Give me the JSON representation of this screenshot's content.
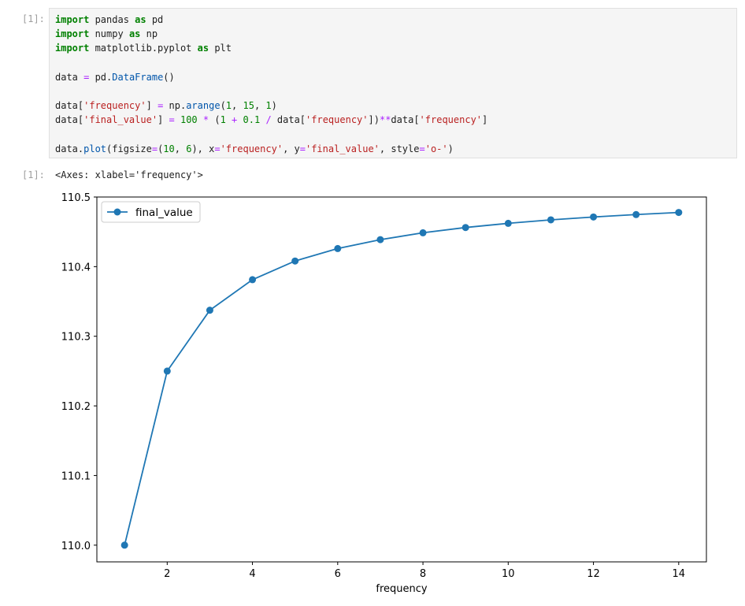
{
  "input_prompt": "[1]:",
  "output_prompt": "[1]:",
  "code": {
    "line1": {
      "kw1": "import",
      "mod": " pandas ",
      "kw2": "as",
      "alias": " pd"
    },
    "line2": {
      "kw1": "import",
      "mod": " numpy ",
      "kw2": "as",
      "alias": " np"
    },
    "line3": {
      "kw1": "import",
      "mod": " matplotlib.pyplot ",
      "kw2": "as",
      "alias": " plt"
    },
    "line5": {
      "a": "data ",
      "op": "=",
      "b": " pd.",
      "fn": "DataFrame",
      "c": "()"
    },
    "line7": {
      "a": "data[",
      "s1": "'frequency'",
      "b": "] ",
      "op1": "=",
      "c": " np.",
      "fn": "arange",
      "d": "(",
      "n1": "1",
      "e": ", ",
      "n2": "15",
      "f": ", ",
      "n3": "1",
      "g": ")"
    },
    "line8": {
      "a": "data[",
      "s1": "'final_value'",
      "b": "] ",
      "op1": "=",
      "c": " ",
      "n1": "100",
      "d": " ",
      "op2": "*",
      "e": " (",
      "n2": "1",
      "f": " ",
      "op3": "+",
      "g": " ",
      "n3": "0.1",
      "h": " ",
      "op4": "/",
      "i": " data[",
      "s2": "'frequency'",
      "j": "])",
      "op5": "**",
      "k": "data[",
      "s3": "'frequency'",
      "l": "]"
    },
    "line10": {
      "a": "data.",
      "fn": "plot",
      "b": "(figsize",
      "op1": "=",
      "c": "(",
      "n1": "10",
      "d": ", ",
      "n2": "6",
      "e": "), x",
      "op2": "=",
      "s1": "'frequency'",
      "f": ", y",
      "op3": "=",
      "s2": "'final_value'",
      "g": ", style",
      "op4": "=",
      "s3": "'o-'",
      "h": ")"
    }
  },
  "output_text": "<Axes: xlabel='frequency'>",
  "colors": {
    "series": "#1f77b4"
  },
  "chart_data": {
    "type": "line",
    "x": [
      1,
      2,
      3,
      4,
      5,
      6,
      7,
      8,
      9,
      10,
      11,
      12,
      13,
      14
    ],
    "series": [
      {
        "name": "final_value",
        "values": [
          110.0,
          110.25,
          110.3374,
          110.3813,
          110.4081,
          110.426,
          110.4388,
          110.4486,
          110.4562,
          110.4622,
          110.4672,
          110.4713,
          110.4748,
          110.4778
        ]
      }
    ],
    "xlabel": "frequency",
    "ylabel": "",
    "xlim": [
      0.35,
      14.65
    ],
    "ylim": [
      109.976,
      110.5
    ],
    "xticks": [
      2,
      4,
      6,
      8,
      10,
      12,
      14
    ],
    "yticks": [
      110.0,
      110.1,
      110.2,
      110.3,
      110.4,
      110.5
    ],
    "xtick_labels": [
      "2",
      "4",
      "6",
      "8",
      "10",
      "12",
      "14"
    ],
    "ytick_labels": [
      "110.0",
      "110.1",
      "110.2",
      "110.3",
      "110.4",
      "110.5"
    ],
    "marker": "o",
    "linestyle": "-",
    "grid": false,
    "legend": "top-left"
  }
}
